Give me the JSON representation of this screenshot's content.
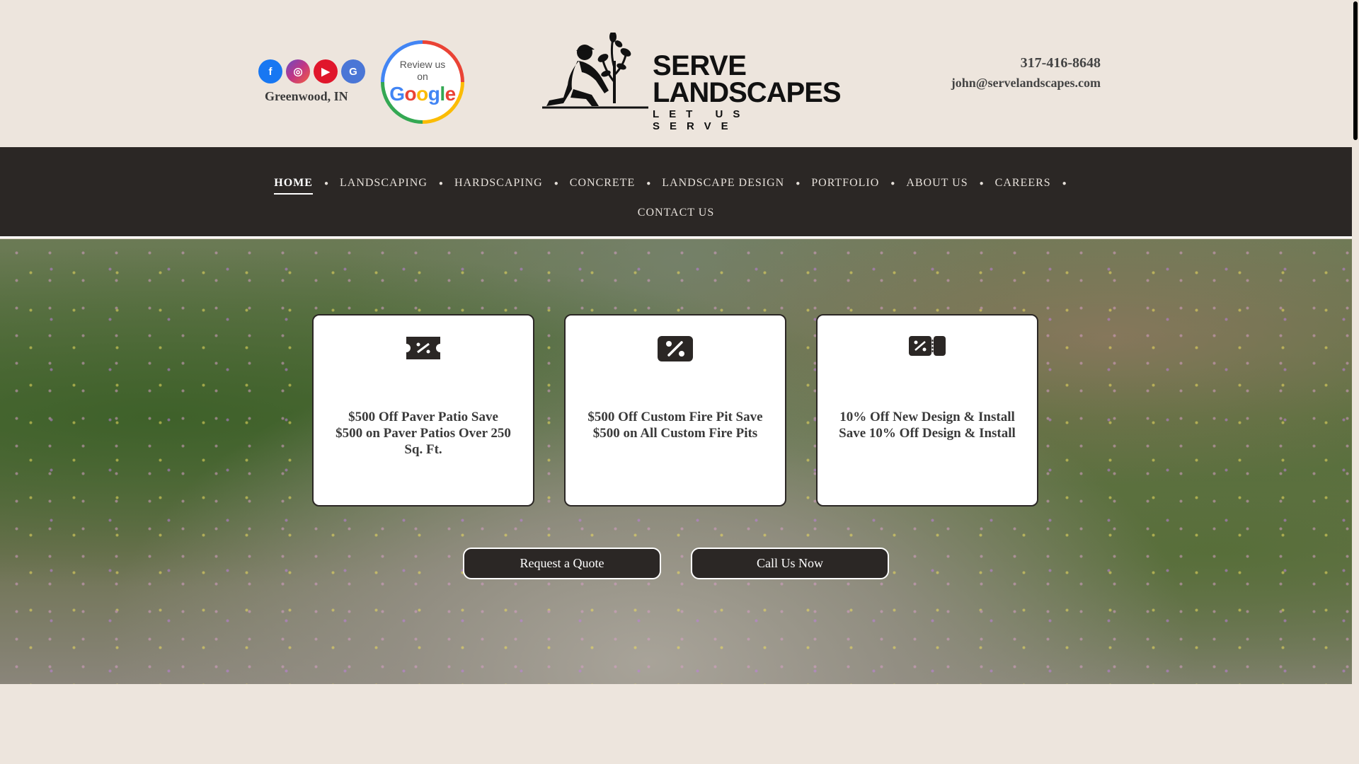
{
  "header": {
    "social": [
      {
        "name": "facebook-icon",
        "glyph": "f"
      },
      {
        "name": "instagram-icon",
        "glyph": "◎"
      },
      {
        "name": "youtube-icon",
        "glyph": "▶"
      },
      {
        "name": "google-business-icon",
        "glyph": "G"
      }
    ],
    "location": "Greenwood, IN",
    "review_badge": {
      "line1": "Review us",
      "line2": "on",
      "brand": "Google"
    },
    "logo": {
      "line1": "SERVE",
      "line2": "LANDSCAPES",
      "tagline": "LET US SERVE"
    },
    "phone": "317-416-8648",
    "email": "john@servelandscapes.com"
  },
  "nav": {
    "items": [
      "HOME",
      "LANDSCAPING",
      "HARDSCAPING",
      "CONCRETE",
      "LANDSCAPE DESIGN",
      "PORTFOLIO",
      "ABOUT US",
      "CAREERS"
    ],
    "second_row": [
      "CONTACT US"
    ],
    "active": "HOME"
  },
  "offers": [
    {
      "icon": "discount-ticket-icon",
      "text": "$500 Off Paver Patio Save $500 on Paver Patios Over 250 Sq. Ft."
    },
    {
      "icon": "percent-badge-icon",
      "text": "$500 Off Custom Fire Pit Save $500 on All Custom Fire Pits"
    },
    {
      "icon": "coupon-tag-icon",
      "text": "10% Off New Design & Install Save 10% Off Design & Install"
    }
  ],
  "buttons": {
    "quote": "Request a Quote",
    "call": "Call Us Now"
  },
  "colors": {
    "background": "#ede5dd",
    "nav_bg": "#2b2725",
    "button_bg": "#2b2725"
  }
}
